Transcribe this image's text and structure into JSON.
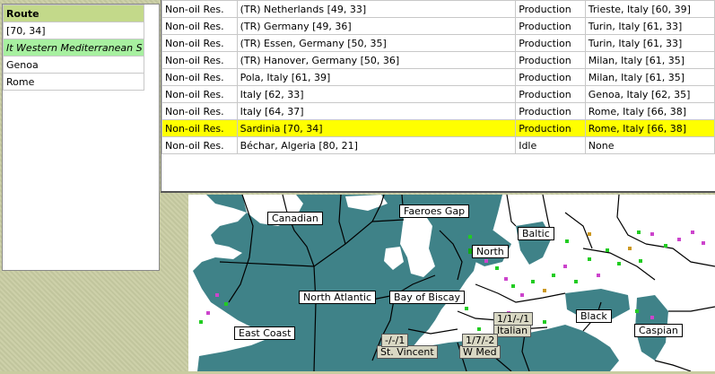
{
  "route_panel": {
    "header": "Route",
    "items": [
      "[70, 34]",
      "It Western Mediterranean S",
      "Genoa",
      "Rome"
    ],
    "selected_index": 1
  },
  "units_table": {
    "rows": [
      {
        "type": "Non-oil Res.",
        "location": "(TR) Netherlands [49, 33]",
        "status": "Production",
        "destination": "Trieste, Italy [60, 39]"
      },
      {
        "type": "Non-oil Res.",
        "location": "(TR) Germany [49, 36]",
        "status": "Production",
        "destination": "Turin, Italy [61, 33]"
      },
      {
        "type": "Non-oil Res.",
        "location": "(TR) Essen, Germany [50, 35]",
        "status": "Production",
        "destination": "Turin, Italy [61, 33]"
      },
      {
        "type": "Non-oil Res.",
        "location": "(TR) Hanover, Germany [50, 36]",
        "status": "Production",
        "destination": "Milan, Italy [61, 35]"
      },
      {
        "type": "Non-oil Res.",
        "location": "Pola, Italy [61, 39]",
        "status": "Production",
        "destination": "Milan, Italy [61, 35]"
      },
      {
        "type": "Non-oil Res.",
        "location": "Italy [62, 33]",
        "status": "Production",
        "destination": "Genoa, Italy [62, 35]"
      },
      {
        "type": "Non-oil Res.",
        "location": "Italy [64, 37]",
        "status": "Production",
        "destination": "Rome, Italy [66, 38]"
      },
      {
        "type": "Non-oil Res.",
        "location": "Sardinia [70, 34]",
        "status": "Production",
        "destination": "Rome, Italy [66, 38]"
      },
      {
        "type": "Non-oil Res.",
        "location": "Béchar, Algeria [80, 21]",
        "status": "Idle",
        "destination": "None"
      }
    ],
    "highlight_index": 7,
    "highlight_color": "#ffff00"
  },
  "map": {
    "sea_color": "#3f8288",
    "land_color": "#ffffff",
    "regions": [
      "Canadian",
      "Faeroes Gap",
      "North",
      "Baltic",
      "North Atlantic",
      "Bay of Biscay",
      "Black",
      "East Coast",
      "Caspian",
      "St. Vincent",
      "W Med",
      "Italian"
    ],
    "tags": [
      "-/-/1",
      "1/7/-2",
      "1/1/-/1"
    ]
  }
}
